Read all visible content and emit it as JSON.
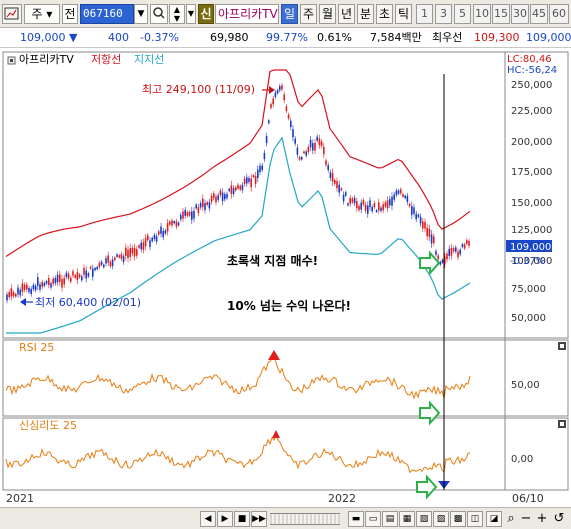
{
  "toolbar": {
    "type_label": "주",
    "market_label": "전",
    "stock_code": "067160",
    "sin_label": "신",
    "stock_name": "아프리카TV",
    "period_tabs": [
      "일",
      "주",
      "월",
      "년",
      "분",
      "초",
      "틱"
    ],
    "interval_buttons": [
      "1",
      "3",
      "5",
      "10",
      "15",
      "30",
      "45",
      "60"
    ]
  },
  "quote": {
    "price": "109,000",
    "change": "400",
    "change_pct": "-0.37%",
    "volume": "69,980",
    "vol_ratio": "99.77%",
    "turnover": "0.61%",
    "amount": "7,584백만",
    "best_label": "최우선",
    "ask": "109,300",
    "bid": "109,000"
  },
  "main_panel": {
    "legend": {
      "name": "아프리카TV",
      "resist": "저항선",
      "support": "지지선"
    },
    "lc_label": "LC:80,46",
    "hc_label": "HC:-56,24",
    "price_ticks": [
      "250,000",
      "225,000",
      "200,000",
      "175,000",
      "150,000",
      "125,000",
      "100,000",
      "75,000",
      "50,000"
    ],
    "last_price_tag": "109,000",
    "last_change_tag": "-0.37%",
    "high_annotation": "최고 249,100 (11/09)",
    "low_annotation": "최저 60,400 (02/01)",
    "note_buy": "초록색 지점 매수!",
    "note_profit": "10% 넘는 수익 나온다!"
  },
  "rsi_panel": {
    "title": "RSI 25",
    "tick": "50,00"
  },
  "psy_panel": {
    "title": "신심리도 25",
    "tick": "0,00"
  },
  "x_axis": {
    "labels": [
      "2021",
      "2022",
      "06/10"
    ]
  },
  "colors": {
    "candle_up": "#e01c1c",
    "candle_down": "#1838c8",
    "resist": "#d8121e",
    "support": "#22a8c8",
    "oscillator": "#e87c10",
    "marker": "#2db04a",
    "annotation_red": "#c81414",
    "annotation_blue": "#1838c8"
  },
  "icons": {
    "chart": "chart-icon",
    "search": "search-icon",
    "updown": "spin-icon",
    "arrow_right": "green-arrow-right-icon",
    "arrow_left": "arrow-left-icon"
  }
}
